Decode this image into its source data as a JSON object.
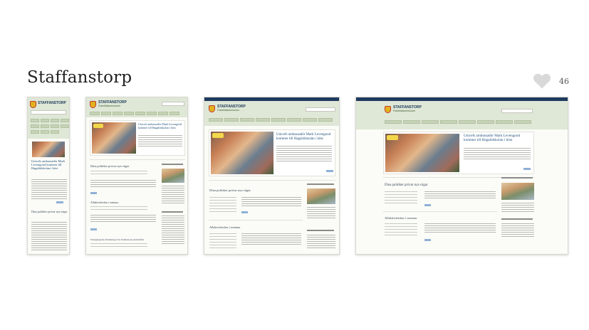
{
  "header": {
    "title": "Staffanstorp"
  },
  "likes": {
    "count": "46",
    "icon": "heart-icon",
    "color": "#d6d6d6"
  },
  "thumbnails": [
    {
      "label": "mobile",
      "logo": "STAFFANSTORP",
      "hero_title": "Unicefs ambassadör Mark Levengood kommer till Hagalidskolan i höst",
      "section_title": "Dina politiker prövar nya vägar"
    },
    {
      "label": "tablet",
      "logo": "STAFFANSTORP",
      "logo_sub": "Framtidskommunen",
      "hero_title": "Unicefs ambassadör Mark Levengood kommer till Hagalidskolan i höst",
      "section_titles": [
        "Dina politiker prövar nya vägar",
        "Allaktivitetshus i sommar",
        "Framgångsrika förändringar för Staffanstorps kulturhålla"
      ]
    },
    {
      "label": "laptop",
      "logo": "STAFFANSTORP",
      "logo_sub": "Framtidskommunen",
      "hero_title": "Unicefs ambassadör Mark Levengood kommer till Hagalidskolan i höst",
      "section_titles": [
        "Dina politiker prövar nya vägar",
        "Allaktivitetshus i sommar"
      ]
    },
    {
      "label": "desktop",
      "logo": "STAFFANSTORP",
      "logo_sub": "Framtidskommunen",
      "hero_title": "Unicefs ambassadör Mark Levengood kommer till Hagalidskolan i höst",
      "section_titles": [
        "Dina politiker prövar nya vägar",
        "Allaktivitetshus i sommar"
      ]
    }
  ]
}
